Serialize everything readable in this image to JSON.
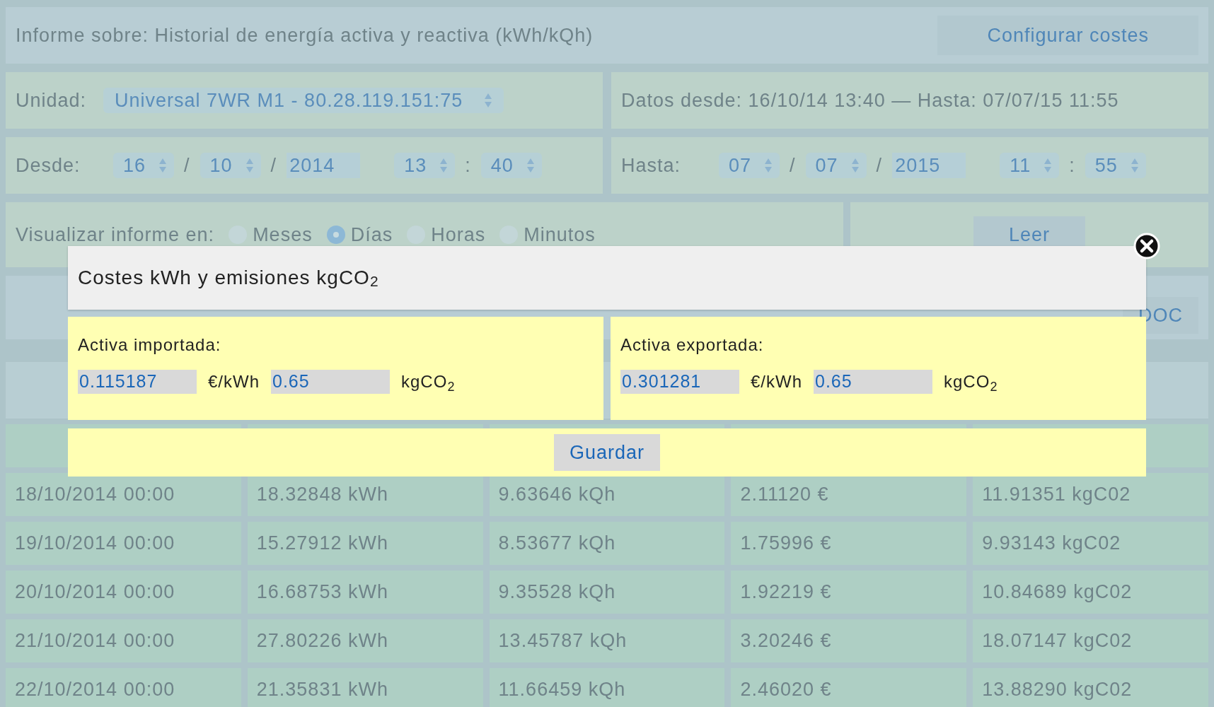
{
  "report": {
    "title": "Informe sobre: Historial de energía activa y reactiva (kWh/kQh)",
    "configure_button": "Configurar costes"
  },
  "unit": {
    "label": "Unidad:",
    "value": "Universal 7WR M1 - 80.28.119.151:75"
  },
  "data_range": "Datos desde: 16/10/14 13:40 — Hasta: 07/07/15 11:55",
  "from": {
    "label": "Desde:",
    "parts": [
      {
        "kind": "spinner",
        "value": "16"
      },
      {
        "kind": "sep",
        "value": "/"
      },
      {
        "kind": "spinner",
        "value": "10"
      },
      {
        "kind": "sep",
        "value": "/"
      },
      {
        "kind": "input",
        "value": "2014"
      },
      {
        "kind": "spinner",
        "value": "13"
      },
      {
        "kind": "sep",
        "value": ":"
      },
      {
        "kind": "spinner",
        "value": "40"
      }
    ]
  },
  "to": {
    "label": "Hasta:",
    "parts": [
      {
        "kind": "spinner",
        "value": "07"
      },
      {
        "kind": "sep",
        "value": "/"
      },
      {
        "kind": "spinner",
        "value": "07"
      },
      {
        "kind": "sep",
        "value": "/"
      },
      {
        "kind": "input",
        "value": "2015"
      },
      {
        "kind": "spinner",
        "value": "11"
      },
      {
        "kind": "sep",
        "value": ":"
      },
      {
        "kind": "spinner",
        "value": "55"
      }
    ]
  },
  "view": {
    "label": "Visualizar informe en:",
    "options": [
      {
        "label": "Meses",
        "selected": false
      },
      {
        "label": "Días",
        "selected": true
      },
      {
        "label": "Horas",
        "selected": false
      },
      {
        "label": "Minutos",
        "selected": false
      }
    ]
  },
  "read_button": "Leer",
  "export_buttons": [
    "DOC"
  ],
  "table": {
    "rows": [
      [
        "18/10/2014 00:00",
        "18.32848 kWh",
        "9.63646 kQh",
        "2.11120 €",
        "11.91351 kgC02"
      ],
      [
        "19/10/2014 00:00",
        "15.27912 kWh",
        "8.53677 kQh",
        "1.75996 €",
        "9.93143 kgC02"
      ],
      [
        "20/10/2014 00:00",
        "16.68753 kWh",
        "9.35528 kQh",
        "1.92219 €",
        "10.84689 kgC02"
      ],
      [
        "21/10/2014 00:00",
        "27.80226 kWh",
        "13.45787 kQh",
        "3.20246 €",
        "18.07147 kgC02"
      ],
      [
        "22/10/2014 00:00",
        "21.35831 kWh",
        "11.66459 kQh",
        "2.46020 €",
        "13.88290 kgC02"
      ]
    ]
  },
  "modal": {
    "title": "Costes kWh y emisiones kgCO$_{2}$",
    "panels": [
      {
        "label": "Activa importada:",
        "price": "0.115187",
        "price_unit": "€/kWh",
        "emission": "0.65",
        "emission_unit": "kgCO$_{2}$"
      },
      {
        "label": "Activa exportada:",
        "price": "0.301281",
        "price_unit": "€/kWh",
        "emission": "0.65",
        "emission_unit": "kgCO$_{2}$"
      }
    ],
    "save_button": "Guardar"
  }
}
